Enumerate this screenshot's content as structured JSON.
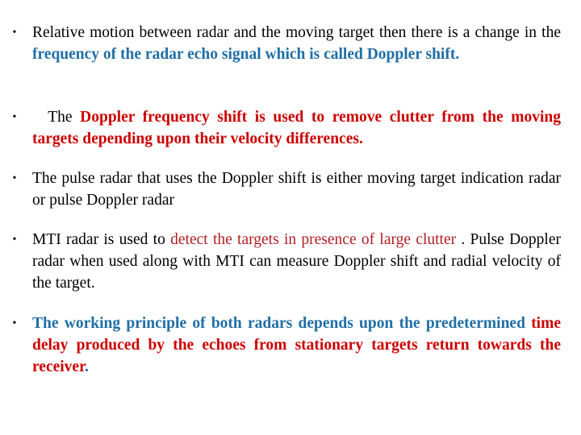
{
  "bullets": [
    {
      "segments": [
        {
          "text": "Relative motion between radar and the moving target then there is a change in the ",
          "style": "black"
        },
        {
          "text": "frequency of the radar echo signal which is called Doppler shift.",
          "style": "blue-bold"
        }
      ]
    },
    {
      "segments": [
        {
          "text": "  The ",
          "style": "black"
        },
        {
          "text": "Doppler frequency shift is used to remove clutter from the moving targets depending upon their velocity differences.",
          "style": "red-bold"
        }
      ]
    },
    {
      "segments": [
        {
          "text": "The pulse radar that uses the Doppler shift is either moving target indication radar or pulse Doppler radar",
          "style": "black"
        }
      ]
    },
    {
      "segments": [
        {
          "text": "MTI radar is used to ",
          "style": "black"
        },
        {
          "text": "detect the targets in presence of large clutter",
          "style": "red-plain"
        },
        {
          "text": " .  Pulse Doppler radar when used along with MTI can measure Doppler shift and radial velocity of the target.",
          "style": "black"
        }
      ]
    },
    {
      "segments": [
        {
          "text": "The working principle of both radars depends upon the predetermined ",
          "style": "blue-bold"
        },
        {
          "text": "time delay produced by the echoes from stationary targets return towards the receiver",
          "style": "red-bold"
        },
        {
          "text": ".",
          "style": "blue-bold"
        }
      ]
    }
  ],
  "bullet_glyph": "•",
  "colors": {
    "blue": "#1F6EA6",
    "red_bold": "#CC0000",
    "red_plain": "#B01E23",
    "text": "#000000"
  }
}
